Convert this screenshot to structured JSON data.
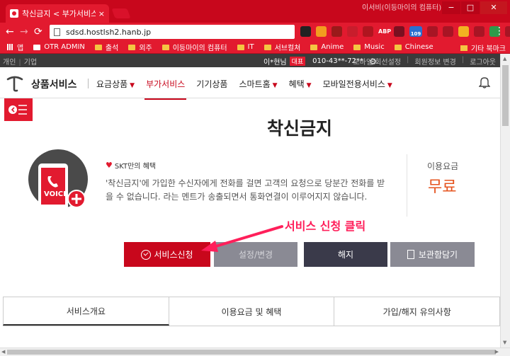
{
  "browser": {
    "tab_title": "착신금지 < 부가서비스",
    "tab_close": "×",
    "window_title": "이서비(이등마이의 컴퓨터) -",
    "url": "sdsd.hostlsh2.hanb.jp",
    "ext_badge": "109",
    "bookmarks": [
      {
        "label": "앱",
        "icon": "apps-grid-icon"
      },
      {
        "label": "OTR ADMIN",
        "icon": "page-icon"
      },
      {
        "label": "출석",
        "icon": "folder-icon"
      },
      {
        "label": "외주",
        "icon": "folder-icon"
      },
      {
        "label": "이등마이의 컴퓨터",
        "icon": "folder-icon"
      },
      {
        "label": "IT",
        "icon": "folder-icon"
      },
      {
        "label": "서브컬쳐",
        "icon": "folder-icon"
      },
      {
        "label": "Anime",
        "icon": "folder-icon"
      },
      {
        "label": "Music",
        "icon": "folder-icon"
      },
      {
        "label": "Chinese",
        "icon": "folder-icon"
      }
    ],
    "other_bookmarks": "기타 북마크",
    "accent": "#e21a2f"
  },
  "utilbar": {
    "personal": "개인",
    "business": "기업",
    "user_name": "이*현님",
    "badge": "대표",
    "phone": "010-43**-72**",
    "right_links": [
      "모바일 회선설정",
      "회원정보 변경",
      "로그아웃"
    ]
  },
  "gnb": {
    "title": "상품서비스",
    "menu": [
      {
        "label": "요금상품",
        "dropdown": true,
        "active": false
      },
      {
        "label": "부가서비스",
        "dropdown": false,
        "active": true
      },
      {
        "label": "기기상품",
        "dropdown": false,
        "active": false
      },
      {
        "label": "스마트홈",
        "dropdown": true,
        "active": false
      },
      {
        "label": "혜택",
        "dropdown": true,
        "active": false
      },
      {
        "label": "모바일전용서비스",
        "dropdown": true,
        "active": false
      }
    ]
  },
  "service": {
    "title": "착신금지",
    "illustration_label": "VOICE",
    "benefit": "SKT만의 혜택",
    "description": "'착신금지'에 가입한 수신자에게 전화를 걸면 고객의 요청으로 당분간 전화를 받을 수 없습니다. 라는 멘트가 송출되면서 통화연결이 이루어지지 않습니다.",
    "fee_label": "이용요금",
    "fee_value": "무료",
    "fee_color": "#e5531e"
  },
  "buttons": {
    "apply": "서비스신청",
    "setting": "설정/변경",
    "cancel": "해지",
    "save": "보관함담기"
  },
  "annotation": "서비스 신청 클릭",
  "tabs": [
    "서비스개요",
    "이용요금 및 혜택",
    "가입/해지 유의사항"
  ]
}
